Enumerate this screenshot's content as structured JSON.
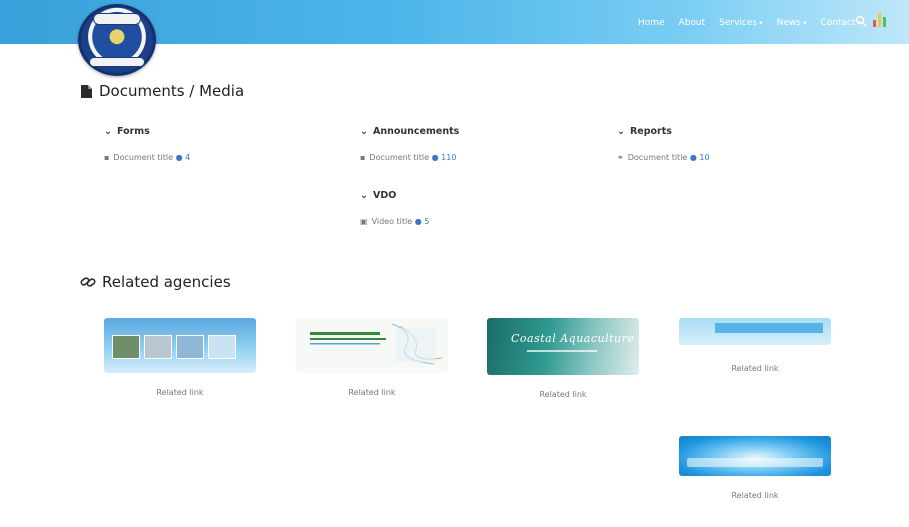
{
  "header": {
    "nav": [
      {
        "label": "Home",
        "has_caret": false
      },
      {
        "label": "About",
        "has_caret": false
      },
      {
        "label": "Services",
        "has_caret": true
      },
      {
        "label": "News",
        "has_caret": true
      },
      {
        "label": "Contact",
        "has_caret": true
      }
    ],
    "icons": {
      "search": "search-icon",
      "chart": "bar-chart-icon"
    },
    "colors": {
      "header_start": "#3aa0db",
      "header_end": "#bfe7f9",
      "link_blue": "#3b78c3"
    }
  },
  "documents": {
    "title": "Documents / Media",
    "columns": [
      {
        "heading": "Forms",
        "items": [
          {
            "text": "Document title",
            "count": "4"
          }
        ]
      },
      {
        "heading": "Announcements",
        "items": [
          {
            "text": "Document title",
            "count": "110"
          }
        ]
      },
      {
        "heading": "Reports",
        "items": [
          {
            "text": "Document title",
            "count": "10"
          }
        ]
      },
      {
        "heading": "VDO",
        "items": [
          {
            "text": "Video title",
            "count": "5"
          }
        ]
      }
    ]
  },
  "related": {
    "title": "Related agencies",
    "cards": [
      {
        "label": "Related link",
        "image_text": ""
      },
      {
        "label": "Related link",
        "image_text": ""
      },
      {
        "label": "Related link",
        "image_text": "Coastal Aquaculture"
      },
      {
        "label": "Related link",
        "image_text": ""
      },
      {
        "label": "Related link",
        "image_text": ""
      }
    ]
  }
}
